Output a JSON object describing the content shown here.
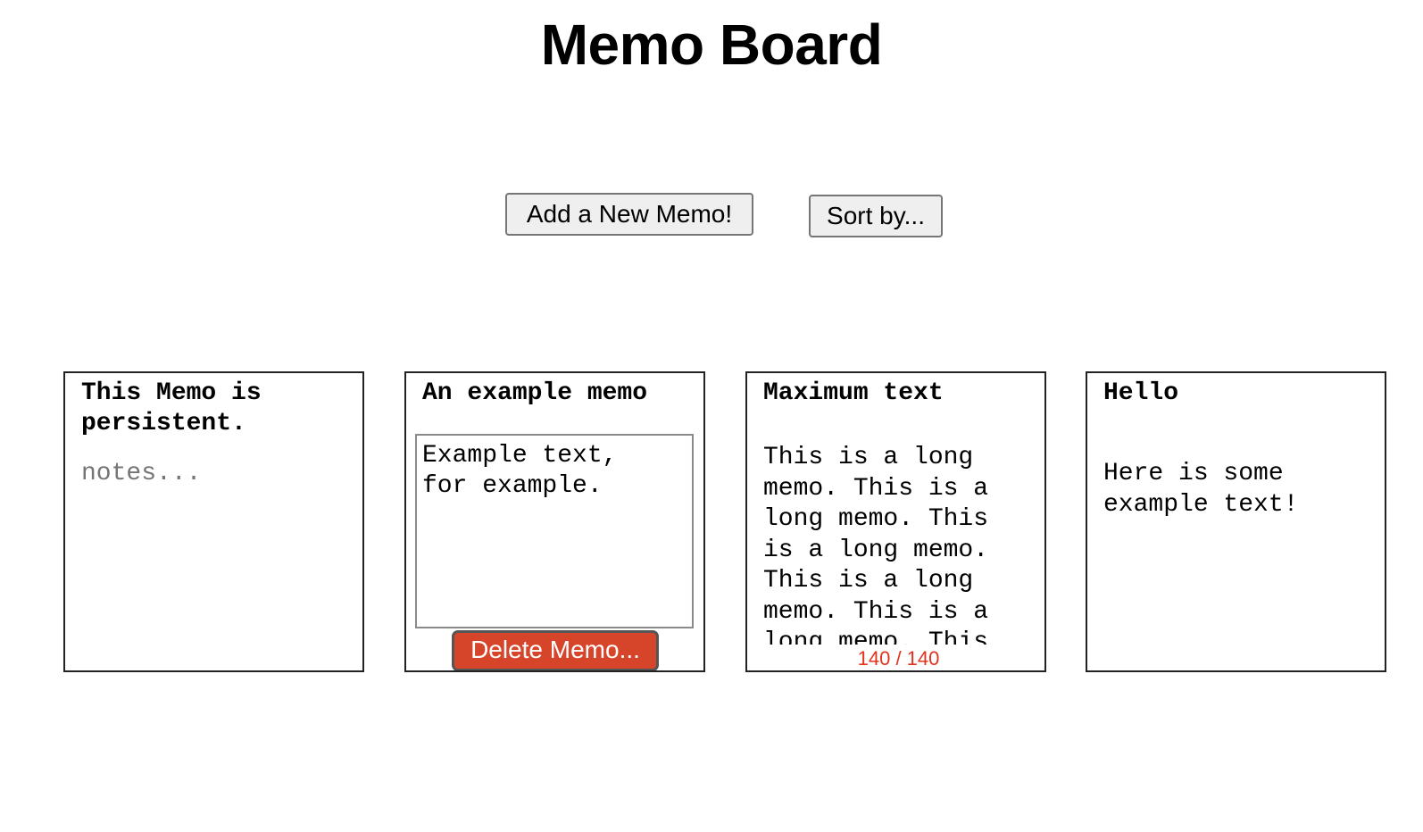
{
  "page": {
    "title": "Memo Board"
  },
  "toolbar": {
    "add_label": "Add a New Memo!",
    "sort_label": "Sort by..."
  },
  "memos": [
    {
      "title": "This Memo is\npersistent.",
      "body": "",
      "placeholder": "notes..."
    },
    {
      "title": "An example memo",
      "body": "Example text,\nfor example.",
      "delete_label": "Delete Memo..."
    },
    {
      "title": "Maximum text",
      "body": "This is a long\nmemo. This is a\nlong memo. This\nis a long memo.\nThis is a long\nmemo. This is a\nlong memo. This",
      "counter": "140 / 140"
    },
    {
      "title": "Hello",
      "body": "Here is some\nexample text!"
    }
  ],
  "colors": {
    "delete_button": "#d6442a",
    "counter_text": "#e2331f",
    "placeholder_text": "#757575"
  }
}
